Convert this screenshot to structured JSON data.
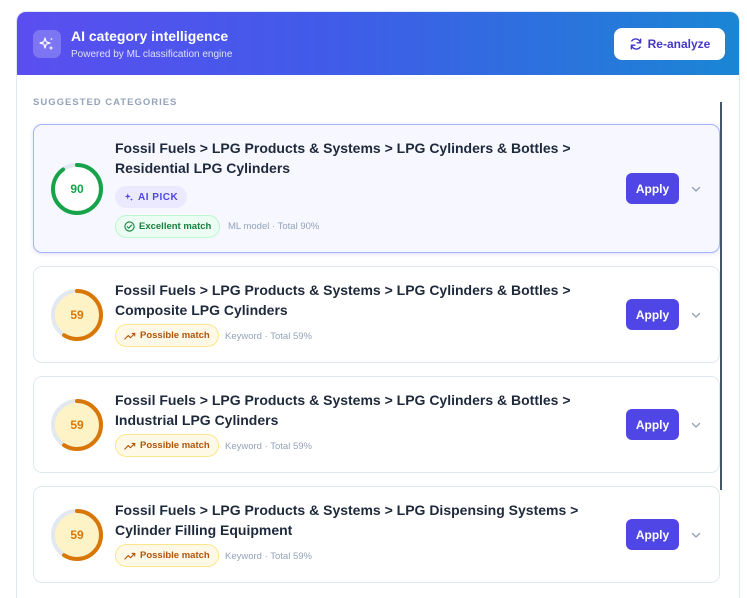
{
  "header": {
    "title": "AI category intelligence",
    "subtitle": "Powered by ML classification engine",
    "reanalyze_label": "Re-analyze",
    "icon": "sparkles-icon"
  },
  "section_label": "SUGGESTED CATEGORIES",
  "colors": {
    "accent": "#4f46e5",
    "excellent": "#16a34a",
    "possible": "#d97706"
  },
  "suggestions": [
    {
      "title": "Fossil Fuels > LPG Products & Systems > LPG Cylinders & Bottles > Residential LPG Cylinders",
      "score": 90,
      "ai_pick": "AI PICK",
      "match": "Excellent match",
      "meta": "ML model · Total 90%",
      "apply": "Apply"
    },
    {
      "title": "Fossil Fuels > LPG Products & Systems > LPG Cylinders & Bottles > Composite LPG Cylinders",
      "score": 59,
      "match": "Possible match",
      "meta": "Keyword · Total 59%",
      "apply": "Apply"
    },
    {
      "title": "Fossil Fuels > LPG Products & Systems > LPG Cylinders & Bottles > Industrial LPG Cylinders",
      "score": 59,
      "match": "Possible match",
      "meta": "Keyword · Total 59%",
      "apply": "Apply"
    },
    {
      "title": "Fossil Fuels > LPG Products & Systems > LPG Dispensing Systems > Cylinder Filling Equipment",
      "score": 59,
      "match": "Possible match",
      "meta": "Keyword · Total 59%",
      "apply": "Apply"
    }
  ]
}
